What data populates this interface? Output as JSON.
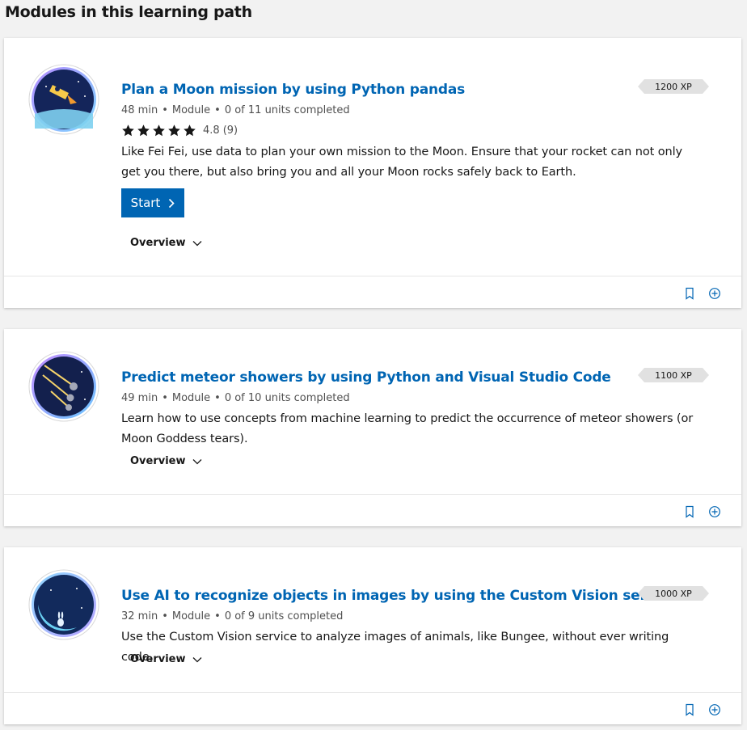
{
  "section_title": "Modules in this learning path",
  "modules": [
    {
      "title": "Plan a Moon mission by using Python pandas",
      "duration": "48 min",
      "type": "Module",
      "progress": "0 of 11 units completed",
      "rating_value": "4.8",
      "rating_count": "(9)",
      "stars": 5,
      "description": "Like Fei Fei, use data to plan your own mission to the Moon. Ensure that your rocket can not only get you there, but also bring you and all your Moon rocks safely back to Earth.",
      "start_label": "Start",
      "overview_label": "Overview",
      "xp": "1200 XP",
      "icon": "rocket-icon"
    },
    {
      "title": "Predict meteor showers by using Python and Visual Studio Code",
      "duration": "49 min",
      "type": "Module",
      "progress": "0 of 10 units completed",
      "description": "Learn how to use concepts from machine learning to predict the occurrence of meteor showers (or Moon Goddess tears).",
      "overview_label": "Overview",
      "xp": "1100 XP",
      "icon": "meteor-icon"
    },
    {
      "title": "Use AI to recognize objects in images by using the Custom Vision service",
      "duration": "32 min",
      "type": "Module",
      "progress": "0 of 9 units completed",
      "description": "Use the Custom Vision service to analyze images of animals, like Bungee, without ever writing code.",
      "overview_label": "Overview",
      "xp": "1000 XP",
      "icon": "rabbit-moon-icon"
    }
  ],
  "colors": {
    "link": "#0065b3",
    "button": "#0065b3",
    "background": "#f2f2f2"
  }
}
